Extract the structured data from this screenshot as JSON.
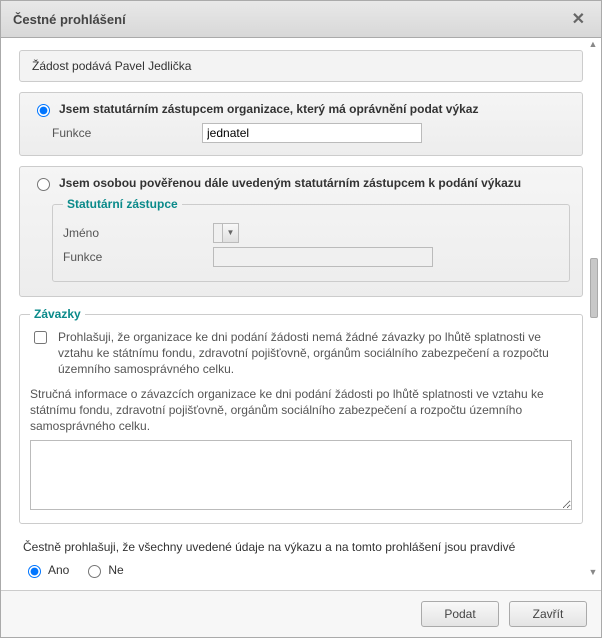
{
  "dialog": {
    "title": "Čestné prohlášení"
  },
  "submitter_line": "Žádost podává Pavel Jedlička",
  "option_statutory": {
    "label": "Jsem statutárním zástupcem organizace, který má oprávnění podat výkaz",
    "funkce_label": "Funkce",
    "funkce_value": "jednatel"
  },
  "option_authorized": {
    "label": "Jsem osobou pověřenou dále uvedeným statutárním zástupcem k podání výkazu",
    "fieldset_title": "Statutární zástupce",
    "jmeno_label": "Jméno",
    "jmeno_value": "",
    "funkce_label": "Funkce",
    "funkce_value": ""
  },
  "zavazky": {
    "title": "Závazky",
    "checkbox_text": "Prohlašuji, že organizace ke dni podání žádosti nemá žádné závazky po lhůtě splatnosti ve vztahu ke státnímu fondu, zdravotní pojišťovně, orgánům sociálního zabezpečení a rozpočtu územního samosprávného celku.",
    "info_text": "Stručná informace o závazcích organizace ke dni podání žádosti po lhůtě splatnosti ve vztahu ke státnímu fondu, zdravotní pojišťovně, orgánům sociálního zabezpečení a rozpočtu územního samosprávného celku.",
    "textarea_value": ""
  },
  "declaration": "Čestně prohlašuji, že všechny uvedené údaje na výkazu a na tomto prohlášení jsou pravdivé",
  "yes_label": "Ano",
  "no_label": "Ne",
  "buttons": {
    "submit": "Podat",
    "close": "Zavřít"
  }
}
